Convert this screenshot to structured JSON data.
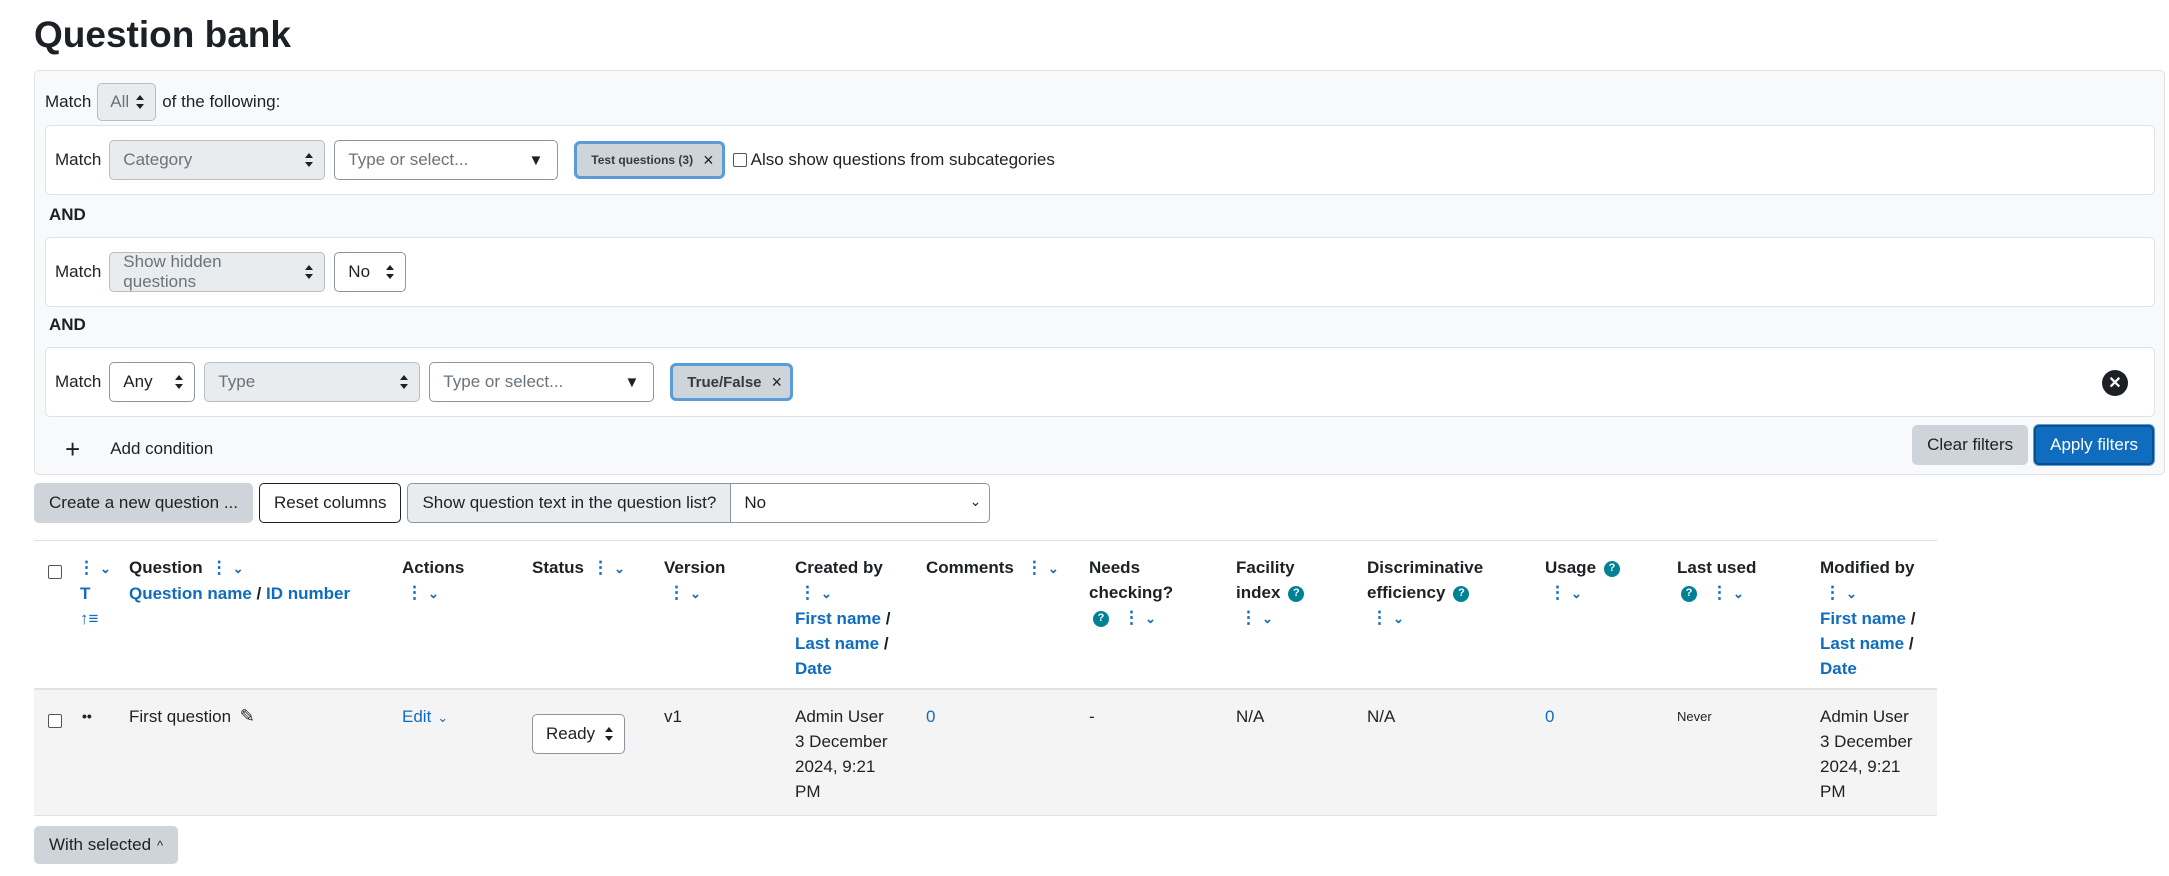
{
  "page": {
    "title": "Question bank"
  },
  "filters": {
    "match_label": "Match",
    "join_value": "All",
    "join_suffix": "of the following:",
    "and_label": "AND",
    "conditions": [
      {
        "field": "Category",
        "typeselect_placeholder": "Type or select...",
        "chip": "Test questions (3)",
        "subcategories_label": "Also show questions from subcategories"
      },
      {
        "field": "Show hidden questions",
        "value": "No"
      },
      {
        "join": "Any",
        "field": "Type",
        "typeselect_placeholder": "Type or select...",
        "chip": "True/False"
      }
    ],
    "add_condition_label": "Add condition",
    "clear_label": "Clear filters",
    "apply_label": "Apply filters"
  },
  "toolbar": {
    "create_label": "Create a new question ...",
    "reset_label": "Reset columns",
    "show_text_label": "Show question text in the question list?",
    "show_text_value": "No"
  },
  "table": {
    "columns": {
      "type_sort": "T",
      "question": "Question",
      "question_name": "Question name",
      "id_number": "ID number",
      "actions": "Actions",
      "status": "Status",
      "version": "Version",
      "created_by": "Created by",
      "first_name": "First name",
      "last_name": "Last name",
      "date": "Date",
      "comments": "Comments",
      "needs_checking_1": "Needs",
      "needs_checking_2": "checking?",
      "facility_1": "Facility",
      "facility_2": "index",
      "discriminative_1": "Discriminative",
      "discriminative_2": "efficiency",
      "usage": "Usage",
      "last_used": "Last used",
      "modified_by": "Modified by",
      "separator": "/"
    },
    "rows": [
      {
        "type_icon": "true-false-icon",
        "question": "First question",
        "action": "Edit",
        "status": "Ready",
        "version": "v1",
        "created_user": "Admin User",
        "created_line1": "3 December",
        "created_line2": "2024, 9:21",
        "created_line3": "PM",
        "comments": "0",
        "needs_checking": "-",
        "facility": "N/A",
        "discriminative": "N/A",
        "usage": "0",
        "last_used": "Never",
        "modified_user": "Admin User",
        "modified_line1": "3 December",
        "modified_line2": "2024, 9:21",
        "modified_line3": "PM"
      }
    ]
  },
  "footer": {
    "with_selected_label": "With selected"
  },
  "colors": {
    "primary": "#0f6cbf",
    "help": "#008196",
    "secondary": "#ced4da"
  }
}
